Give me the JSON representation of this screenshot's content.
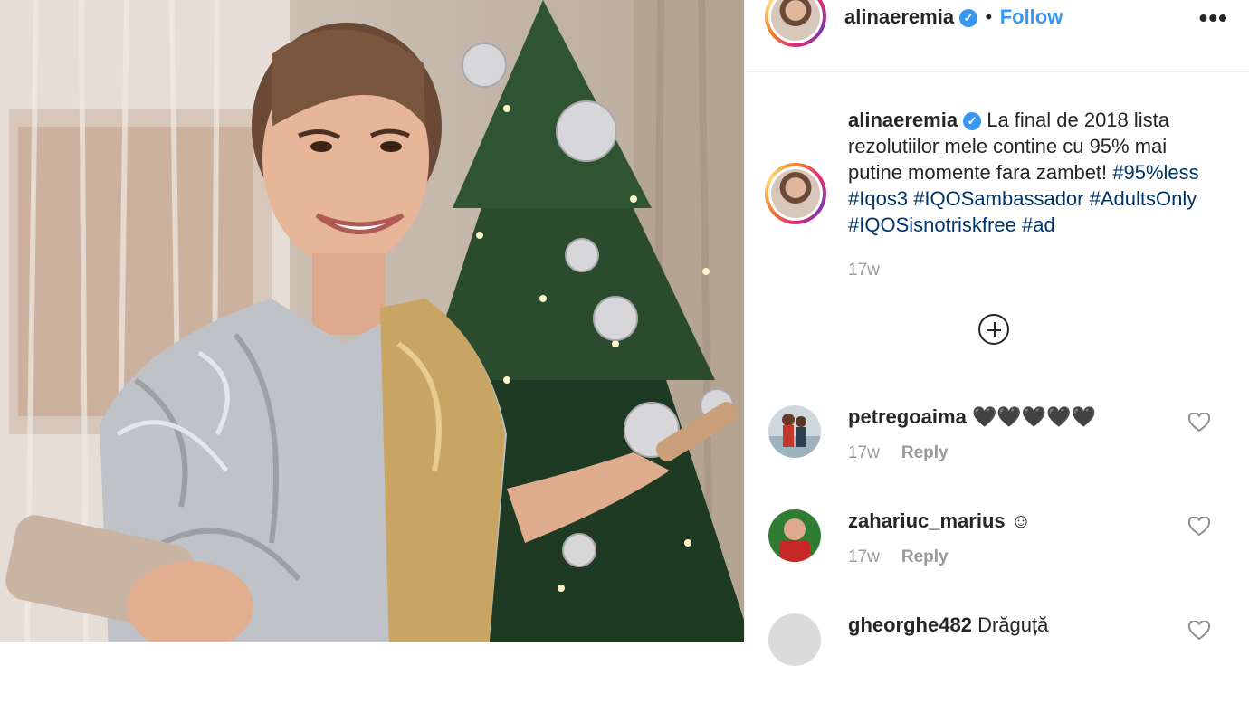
{
  "post": {
    "username": "alinaeremia",
    "separator": "•",
    "follow_label": "Follow",
    "more_label": "•••",
    "caption": "La final de 2018 lista rezolutiilor mele contine cu 95% mai putine momente fara zambet!",
    "hashtags": [
      "#95%less",
      "#Iqos3",
      "#IQOSambassador",
      "#AdultsOnly",
      "#IQOSisnotriskfree",
      "#ad"
    ],
    "caption_time": "17w",
    "verified_mark": "✓"
  },
  "comments": [
    {
      "username": "petregoaima",
      "text": "🖤🖤🖤🖤🖤",
      "time": "17w",
      "reply_label": "Reply"
    },
    {
      "username": "zahariuc_marius",
      "text": "☺",
      "time": "17w",
      "reply_label": "Reply"
    },
    {
      "username": "gheorghe482",
      "text": "Drăguță",
      "time": "",
      "reply_label": ""
    }
  ],
  "icons": {
    "verified": "verified-badge-icon",
    "load_more": "plus-circle-icon",
    "like": "heart-icon",
    "more": "more-options-icon"
  },
  "colors": {
    "link_blue": "#3897f0",
    "hashtag": "#003569",
    "muted": "#999999",
    "text": "#262626"
  }
}
